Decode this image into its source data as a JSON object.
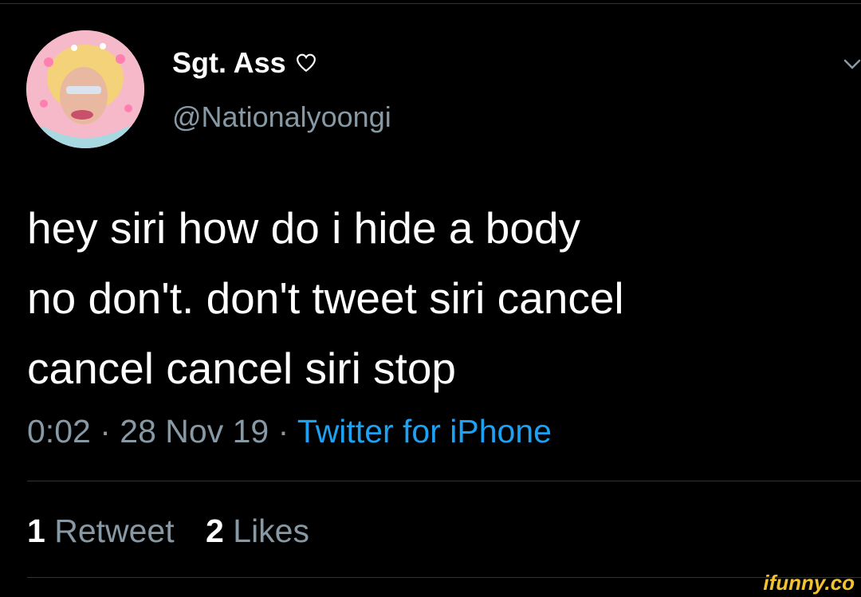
{
  "tweet": {
    "display_name": "Sgt. Ass",
    "name_icon": "heart-outline-icon",
    "handle": "@Nationalyoongi",
    "text_lines": [
      "hey siri how do i hide a body",
      "no don't. don't tweet siri cancel",
      "cancel cancel siri stop"
    ],
    "time": "0:02",
    "date": "28 Nov 19",
    "separator": "·",
    "source": "Twitter for iPhone",
    "retweets": {
      "count": "1",
      "label": "Retweet"
    },
    "likes": {
      "count": "2",
      "label": "Likes"
    }
  },
  "icons": {
    "more": "chevron-down-icon"
  },
  "colors": {
    "background": "#000000",
    "primary_text": "#ffffff",
    "secondary_text": "#8899a6",
    "link": "#1da1f2",
    "divider": "#2f3336"
  },
  "watermark": {
    "text": "ifunny.co"
  }
}
